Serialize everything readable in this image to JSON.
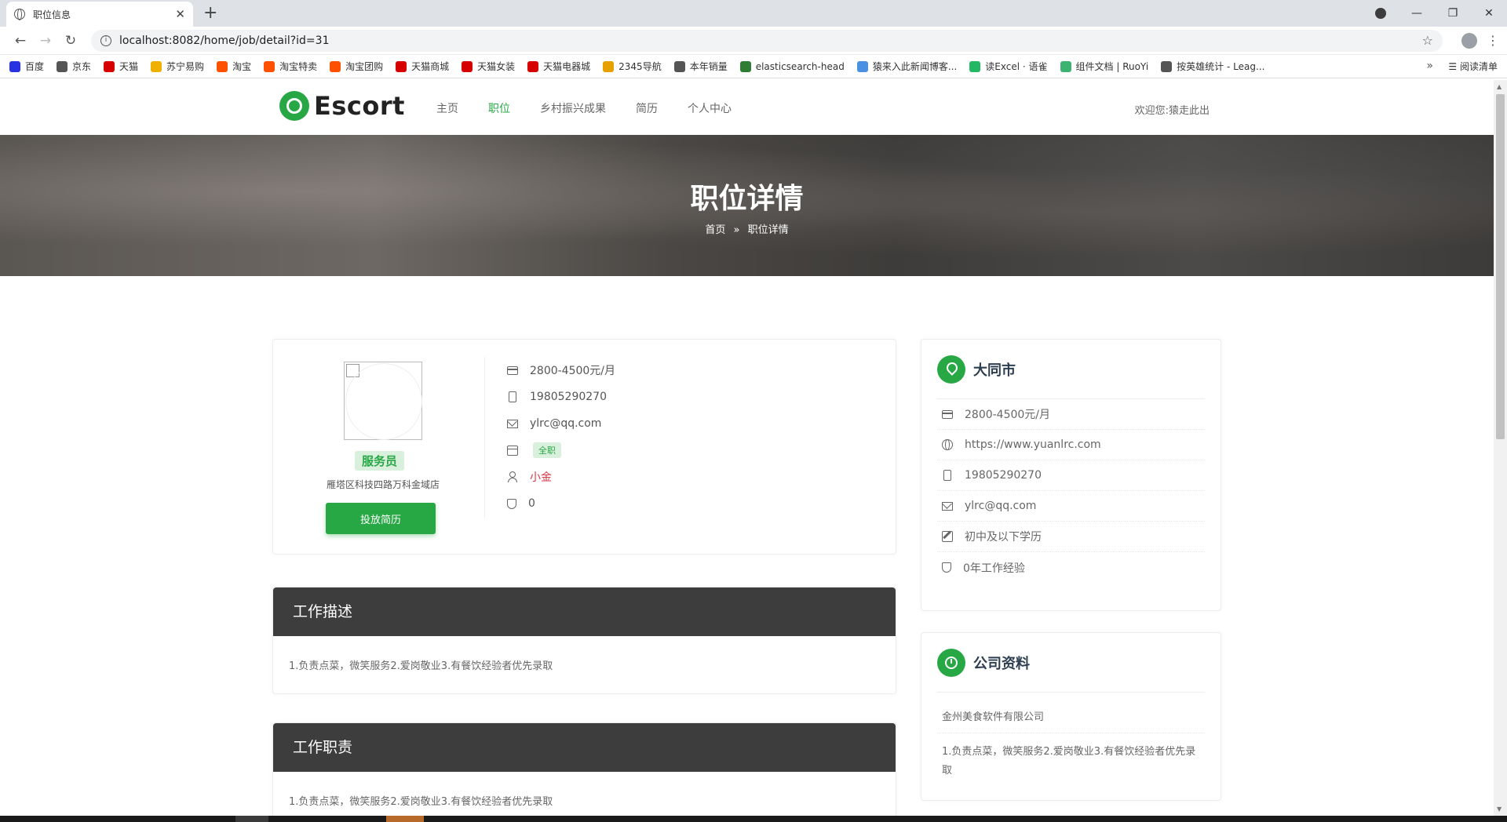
{
  "browser": {
    "tab_title": "职位信息",
    "url": "localhost:8082/home/job/detail?id=31",
    "bookmarks": [
      {
        "label": "百度",
        "color": "#2932e1"
      },
      {
        "label": "京东",
        "color": "#555555"
      },
      {
        "label": "天猫",
        "color": "#d60000"
      },
      {
        "label": "苏宁易购",
        "color": "#f0b000"
      },
      {
        "label": "淘宝",
        "color": "#ff5000"
      },
      {
        "label": "淘宝特卖",
        "color": "#ff5000"
      },
      {
        "label": "淘宝团购",
        "color": "#ff5000"
      },
      {
        "label": "天猫商城",
        "color": "#d60000"
      },
      {
        "label": "天猫女装",
        "color": "#d60000"
      },
      {
        "label": "天猫电器城",
        "color": "#d60000"
      },
      {
        "label": "2345导航",
        "color": "#e6a100"
      },
      {
        "label": "本年销量",
        "color": "#555555"
      },
      {
        "label": "elasticsearch-head",
        "color": "#2e7d32"
      },
      {
        "label": "猿来入此新闻博客...",
        "color": "#4a90e2"
      },
      {
        "label": "读Excel · 语雀",
        "color": "#25b864"
      },
      {
        "label": "组件文档 | RuoYi",
        "color": "#3cb371"
      },
      {
        "label": "按英雄统计 - Leag...",
        "color": "#555555"
      }
    ],
    "reading_list": "阅读清单"
  },
  "site": {
    "logo": "Escort",
    "nav": [
      "主页",
      "职位",
      "乡村振兴成果",
      "简历",
      "个人中心"
    ],
    "active_nav": "职位",
    "welcome": "欢迎您:猿走此出",
    "accent": "#28a745"
  },
  "hero": {
    "title": "职位详情",
    "crumb_home": "首页",
    "crumb_current": "职位详情"
  },
  "job": {
    "title": "服务员",
    "address": "雁塔区科技四路万科金域店",
    "apply_label": "投放简历",
    "salary": "2800-4500元/月",
    "phone": "19805290270",
    "email": "ylrc@qq.com",
    "type": "全职",
    "contact": "小金",
    "count": "0"
  },
  "sections": [
    {
      "title": "工作描述",
      "body": "1.负责点菜，微笑服务2.爱岗敬业3.有餐饮经验者优先录取"
    },
    {
      "title": "工作职责",
      "body": "1.负责点菜，微笑服务2.爱岗敬业3.有餐饮经验者优先录取"
    }
  ],
  "city_card": {
    "city": "大同市",
    "salary": "2800-4500元/月",
    "website": "https://www.yuanlrc.com",
    "phone": "19805290270",
    "email": "ylrc@qq.com",
    "education": "初中及以下学历",
    "experience": "0年工作经验"
  },
  "company_card": {
    "title": "公司资料",
    "name": "金州美食软件有限公司",
    "description": "1.负责点菜，微笑服务2.爱岗敬业3.有餐饮经验者优先录取"
  }
}
